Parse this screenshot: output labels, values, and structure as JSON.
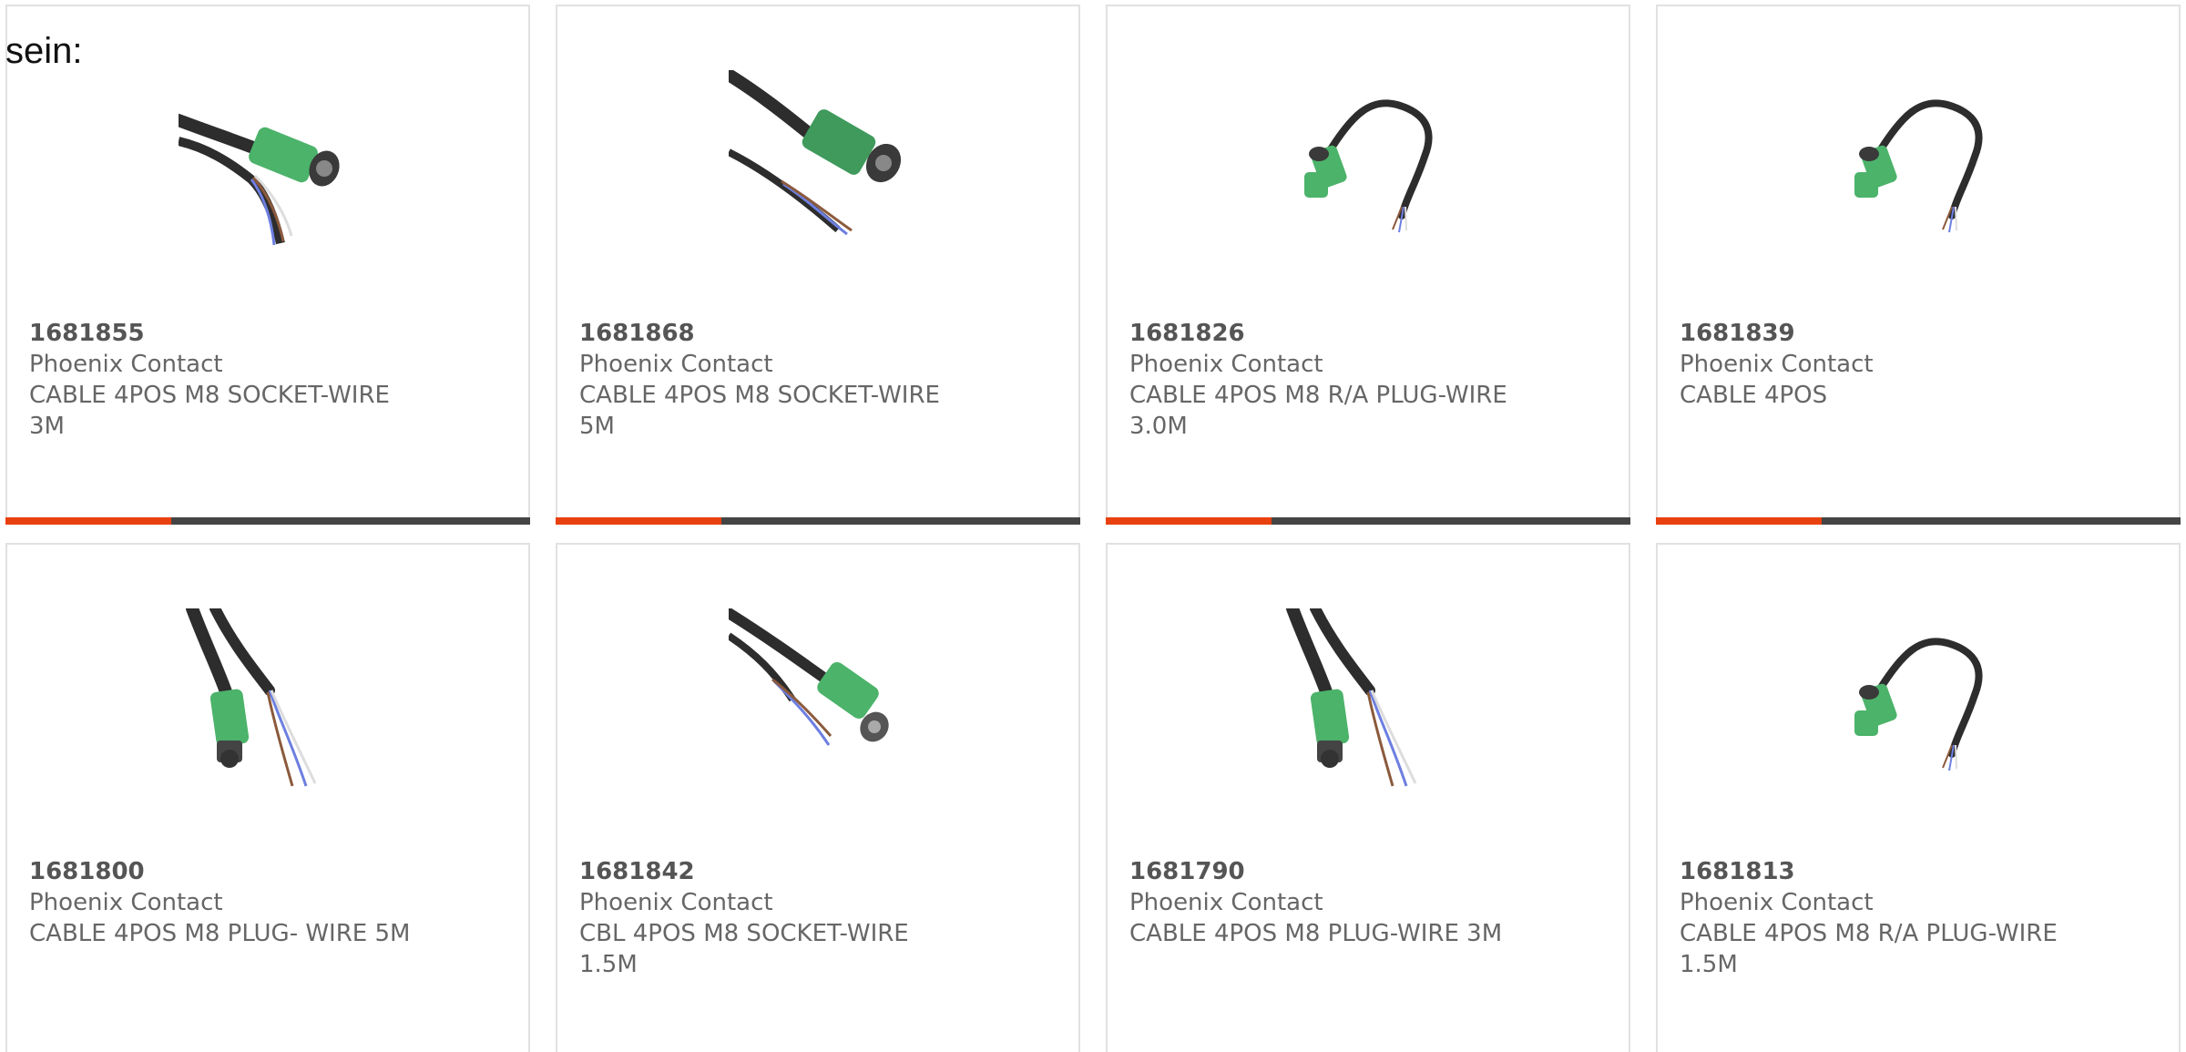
{
  "intro_text": "sein:",
  "colors": {
    "accent": "#e8400f",
    "bar": "#444444",
    "connector_green": "#4cb36a",
    "cable": "#2d2d2d"
  },
  "products": [
    {
      "part": "1681855",
      "maker": "Phoenix Contact",
      "desc": "CABLE 4POS M8 SOCKET-WIRE 3M",
      "image": "straight-socket-cable-image"
    },
    {
      "part": "1681868",
      "maker": "Phoenix Contact",
      "desc": "CABLE 4POS M8 SOCKET-WIRE 5M",
      "image": "straight-socket-cable-image"
    },
    {
      "part": "1681826",
      "maker": "Phoenix Contact",
      "desc": "CABLE 4POS M8 R/A PLUG-WIRE 3.0M",
      "image": "right-angle-plug-cable-image"
    },
    {
      "part": "1681839",
      "maker": "Phoenix Contact",
      "desc": "CABLE 4POS",
      "image": "right-angle-plug-cable-image"
    },
    {
      "part": "1681800",
      "maker": "Phoenix Contact",
      "desc": "CABLE 4POS M8 PLUG- WIRE 5M",
      "image": "straight-plug-cable-image"
    },
    {
      "part": "1681842",
      "maker": "Phoenix Contact",
      "desc": "CBL 4POS M8 SOCKET-WIRE 1.5M",
      "image": "straight-socket-cable-image"
    },
    {
      "part": "1681790",
      "maker": "Phoenix Contact",
      "desc": "CABLE 4POS M8 PLUG-WIRE 3M",
      "image": "straight-plug-cable-image"
    },
    {
      "part": "1681813",
      "maker": "Phoenix Contact",
      "desc": "CABLE 4POS M8 R/A PLUG-WIRE 1.5M",
      "image": "right-angle-plug-cable-image"
    }
  ]
}
